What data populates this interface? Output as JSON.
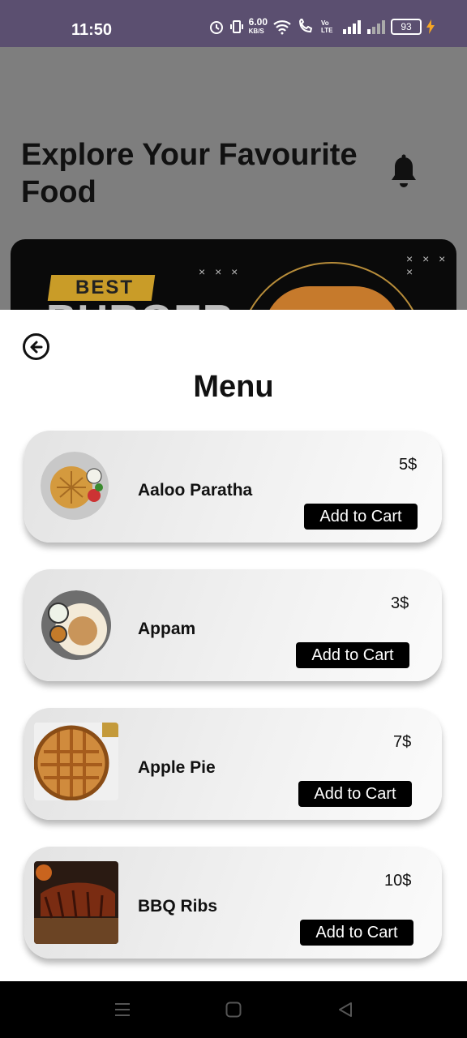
{
  "status_bar": {
    "time": "11:50",
    "net_speed_value": "6.00",
    "net_speed_unit": "KB/S",
    "lte_label": "Vo LTE",
    "battery": "93"
  },
  "header": {
    "title": "Explore Your Favourite Food",
    "bell_icon": "bell-icon"
  },
  "banner": {
    "tag": "BEST",
    "headline": "BURGER",
    "deco": "× × ×",
    "deco2": "× × × ×"
  },
  "menu": {
    "back_icon": "arrow-left-circle-icon",
    "title": "Menu",
    "items": [
      {
        "name": "Aaloo Paratha",
        "price": "5$",
        "button": "Add to Cart"
      },
      {
        "name": "Appam",
        "price": "3$",
        "button": "Add to Cart"
      },
      {
        "name": "Apple Pie",
        "price": "7$",
        "button": "Add to Cart"
      },
      {
        "name": "BBQ Ribs",
        "price": "10$",
        "button": "Add to Cart"
      }
    ]
  },
  "nav": {
    "menu_icon": "recent-apps-icon",
    "home_icon": "home-icon",
    "back_icon": "back-triangle-icon"
  },
  "colors": {
    "status_bar": "#5b4f70",
    "button": "#000000",
    "accent_gold": "#c99c28"
  }
}
